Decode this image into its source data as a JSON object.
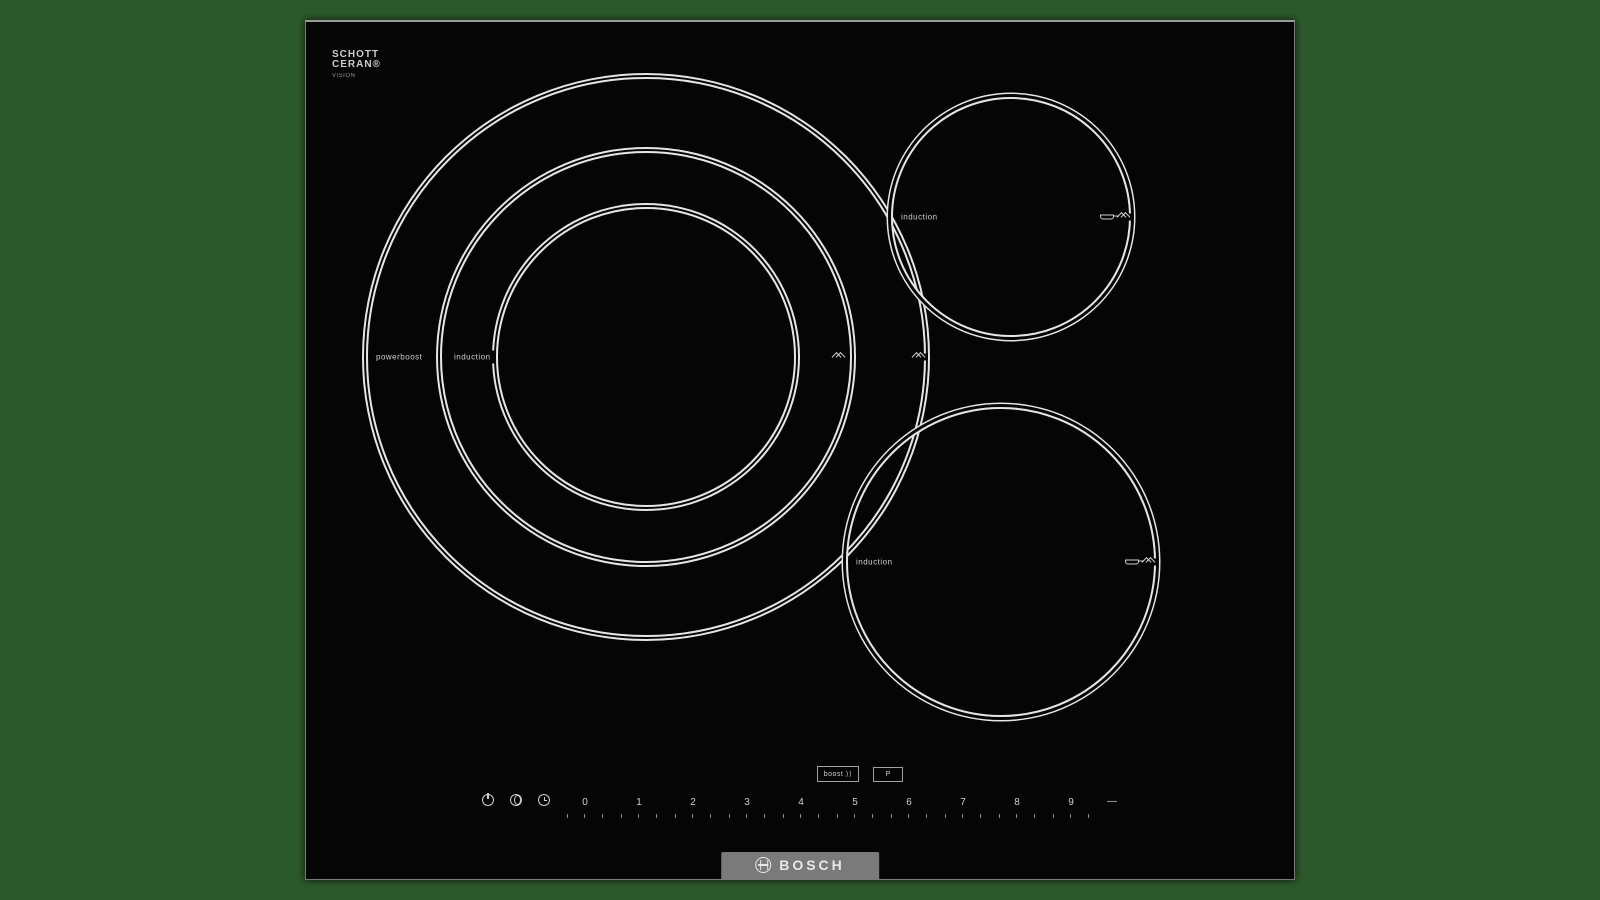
{
  "glass_logo": {
    "line1": "SCHOTT",
    "line2": "CERAN®",
    "sub": "VISION"
  },
  "brand": "BOSCH",
  "zones": {
    "large": {
      "label_outer": "powerboost",
      "label_inner": "induction"
    },
    "top_right": {
      "label": "induction"
    },
    "bottom_right": {
      "label": "induction"
    }
  },
  "controls": {
    "boost_label": "boost",
    "boost_symbol": "⟩⟩",
    "p_label": "P",
    "numbers": [
      "0",
      "1",
      "2",
      "3",
      "4",
      "5",
      "6",
      "7",
      "8",
      "9"
    ],
    "minus_symbol": "—"
  }
}
